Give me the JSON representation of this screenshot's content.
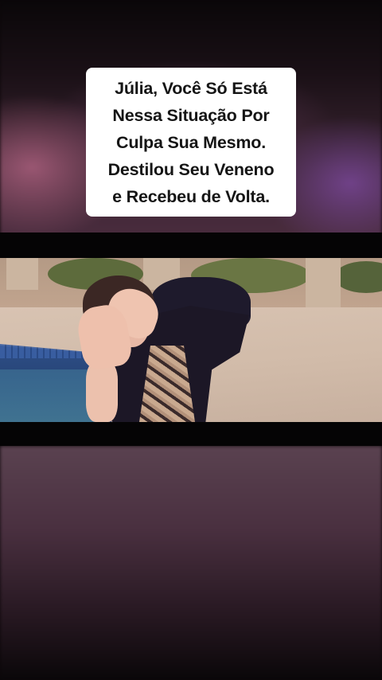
{
  "caption": {
    "lines": [
      "Júlia, Você Só Está",
      "Nessa Situação Por",
      "Culpa Sua Mesmo.",
      "Destilou Seu Veneno",
      "e Recebeu de Volta."
    ]
  },
  "colors": {
    "caption_background": "#ffffff",
    "caption_text": "#151515",
    "letterbox": "#050405"
  }
}
